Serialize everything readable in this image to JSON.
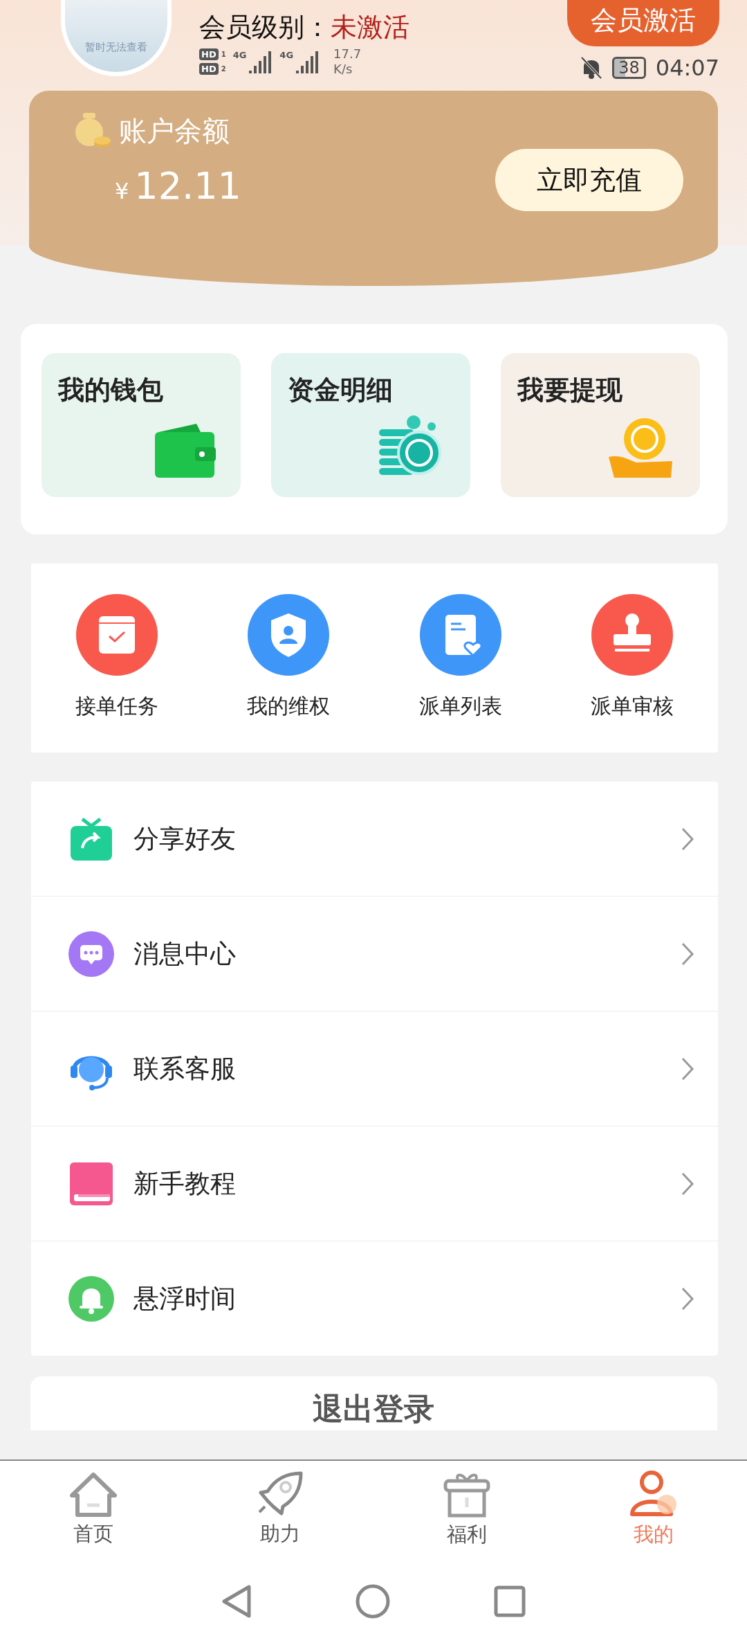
{
  "header": {
    "avatar_caption": "暂时无法查看",
    "member_label": "会员级别：",
    "member_status": "未激活",
    "activate_button": "会员激活"
  },
  "status_bar": {
    "sims": [
      {
        "badge": "HD",
        "slot": "1",
        "network": "4G"
      },
      {
        "badge": "HD",
        "slot": "2",
        "network": "4G"
      }
    ],
    "speed": "17.7",
    "speed_unit": "K/s",
    "battery": "38",
    "time": "04:07"
  },
  "balance": {
    "title": "账户余额",
    "currency": "¥",
    "amount": "12.11",
    "recharge_button": "立即充值"
  },
  "wallet_tiles": [
    "我的钱包",
    "资金明细",
    "我要提现"
  ],
  "services": [
    "接单任务",
    "我的维权",
    "派单列表",
    "派单审核"
  ],
  "menu": [
    "分享好友",
    "消息中心",
    "联系客服",
    "新手教程",
    "悬浮时间"
  ],
  "logout_button": "退出登录",
  "tabs": [
    {
      "label": "首页",
      "selected": false
    },
    {
      "label": "助力",
      "selected": false
    },
    {
      "label": "福利",
      "selected": false
    },
    {
      "label": "我的",
      "selected": true
    }
  ]
}
